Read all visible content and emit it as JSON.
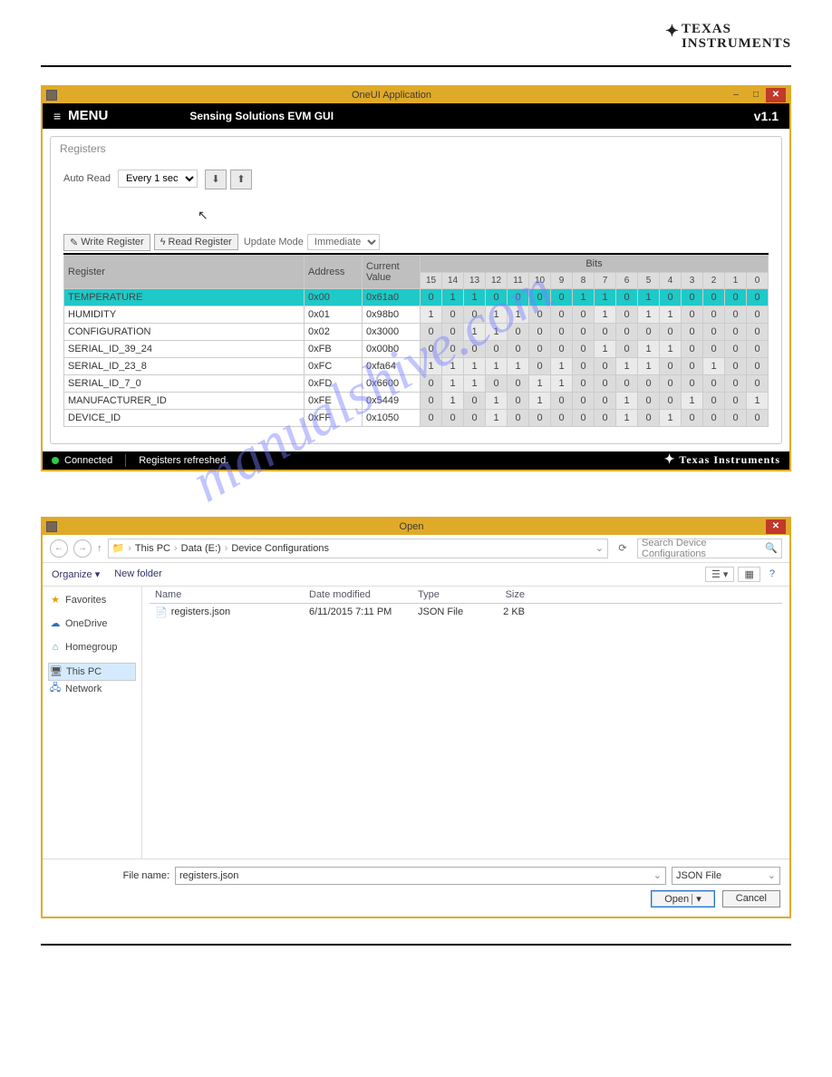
{
  "logo_top": {
    "line1": "TEXAS",
    "line2": "INSTRUMENTS"
  },
  "watermark": "manualshive.com",
  "window1": {
    "title": "OneUI Application",
    "menu_label": "MENU",
    "subtitle": "Sensing Solutions EVM GUI",
    "version": "v1.1",
    "panel_title": "Registers",
    "auto_read_label": "Auto Read",
    "auto_read_value": "Every 1 sec",
    "write_btn": "Write Register",
    "read_btn": "Read Register",
    "update_mode_label": "Update Mode",
    "update_mode_value": "Immediate",
    "table": {
      "col_register": "Register",
      "col_address": "Address",
      "col_value": "Current Value",
      "col_bits": "Bits",
      "bit_headers": [
        "15",
        "14",
        "13",
        "12",
        "11",
        "10",
        "9",
        "8",
        "7",
        "6",
        "5",
        "4",
        "3",
        "2",
        "1",
        "0"
      ],
      "rows": [
        {
          "name": "TEMPERATURE",
          "addr": "0x00",
          "val": "0x61a0",
          "bits": [
            "0",
            "1",
            "1",
            "0",
            "0",
            "0",
            "0",
            "1",
            "1",
            "0",
            "1",
            "0",
            "0",
            "0",
            "0",
            "0"
          ],
          "hl": true
        },
        {
          "name": "HUMIDITY",
          "addr": "0x01",
          "val": "0x98b0",
          "bits": [
            "1",
            "0",
            "0",
            "1",
            "1",
            "0",
            "0",
            "0",
            "1",
            "0",
            "1",
            "1",
            "0",
            "0",
            "0",
            "0"
          ]
        },
        {
          "name": "CONFIGURATION",
          "addr": "0x02",
          "val": "0x3000",
          "bits": [
            "0",
            "0",
            "1",
            "1",
            "0",
            "0",
            "0",
            "0",
            "0",
            "0",
            "0",
            "0",
            "0",
            "0",
            "0",
            "0"
          ]
        },
        {
          "name": "SERIAL_ID_39_24",
          "addr": "0xFB",
          "val": "0x00b0",
          "bits": [
            "0",
            "0",
            "0",
            "0",
            "0",
            "0",
            "0",
            "0",
            "1",
            "0",
            "1",
            "1",
            "0",
            "0",
            "0",
            "0"
          ]
        },
        {
          "name": "SERIAL_ID_23_8",
          "addr": "0xFC",
          "val": "0xfa64",
          "bits": [
            "1",
            "1",
            "1",
            "1",
            "1",
            "0",
            "1",
            "0",
            "0",
            "1",
            "1",
            "0",
            "0",
            "1",
            "0",
            "0"
          ]
        },
        {
          "name": "SERIAL_ID_7_0",
          "addr": "0xFD",
          "val": "0x6600",
          "bits": [
            "0",
            "1",
            "1",
            "0",
            "0",
            "1",
            "1",
            "0",
            "0",
            "0",
            "0",
            "0",
            "0",
            "0",
            "0",
            "0"
          ]
        },
        {
          "name": "MANUFACTURER_ID",
          "addr": "0xFE",
          "val": "0x5449",
          "bits": [
            "0",
            "1",
            "0",
            "1",
            "0",
            "1",
            "0",
            "0",
            "0",
            "1",
            "0",
            "0",
            "1",
            "0",
            "0",
            "1"
          ]
        },
        {
          "name": "DEVICE_ID",
          "addr": "0xFF",
          "val": "0x1050",
          "bits": [
            "0",
            "0",
            "0",
            "1",
            "0",
            "0",
            "0",
            "0",
            "0",
            "1",
            "0",
            "1",
            "0",
            "0",
            "0",
            "0"
          ]
        }
      ]
    },
    "status_connected": "Connected",
    "status_msg": "Registers refreshed.",
    "footer_brand": "Texas Instruments",
    "red_cells": [
      [
        1,
        8
      ],
      [
        3,
        8
      ],
      [
        1,
        10
      ],
      [
        3,
        10
      ]
    ]
  },
  "window2": {
    "title": "Open",
    "breadcrumb": [
      "This PC",
      "Data (E:)",
      "Device Configurations"
    ],
    "search_placeholder": "Search Device Configurations",
    "organize": "Organize",
    "new_folder": "New folder",
    "sidenav": [
      {
        "label": "Favorites",
        "icon": "★",
        "color": "#e2a200"
      },
      {
        "label": "OneDrive",
        "icon": "☁",
        "color": "#2a6fbe"
      },
      {
        "label": "Homegroup",
        "icon": "⌂",
        "color": "#2a9fbe"
      },
      {
        "label": "This PC",
        "icon": "🖥",
        "color": "#555",
        "selected": true
      },
      {
        "label": "Network",
        "icon": "🖧",
        "color": "#2a6fbe"
      }
    ],
    "file_headers": {
      "name": "Name",
      "dm": "Date modified",
      "ty": "Type",
      "sz": "Size"
    },
    "files": [
      {
        "name": "registers.json",
        "dm": "6/11/2015 7:11 PM",
        "ty": "JSON File",
        "sz": "2 KB"
      }
    ],
    "filename_label": "File name:",
    "filename_value": "registers.json",
    "filter_value": "JSON File",
    "open_btn": "Open",
    "cancel_btn": "Cancel"
  }
}
